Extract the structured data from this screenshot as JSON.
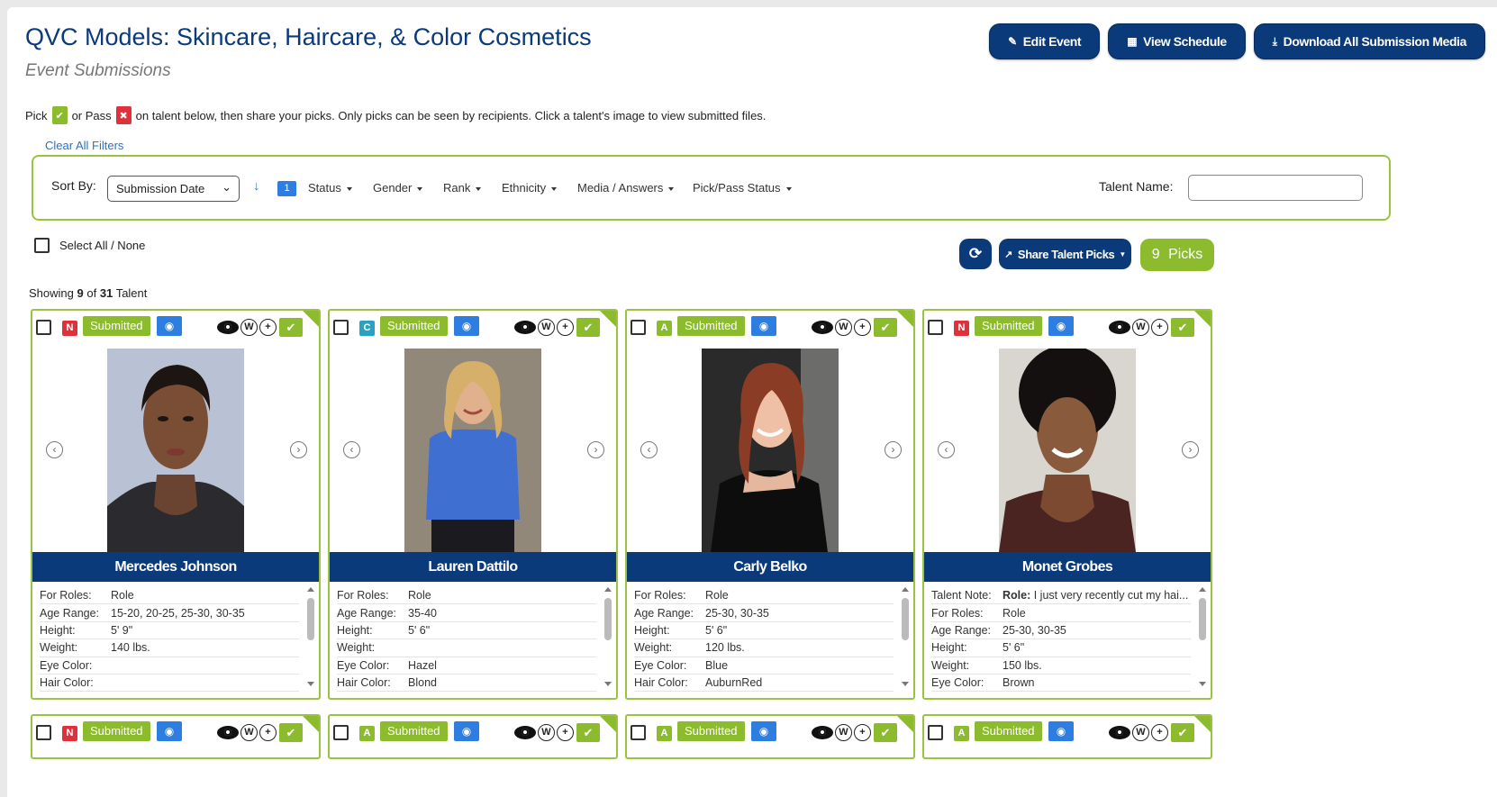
{
  "header": {
    "title": "QVC Models: Skincare, Haircare, & Color Cosmetics",
    "subtitle": "Event Submissions",
    "buttons": [
      {
        "label": "Edit Event",
        "icon": "edit-icon"
      },
      {
        "label": "View Schedule",
        "icon": "calendar-icon"
      },
      {
        "label": "Download All Submission Media",
        "icon": "download-icon"
      }
    ]
  },
  "instructions": {
    "pick_text": "Pick",
    "or_pass_text": "or Pass",
    "rest_text": "on talent below, then share your picks. Only picks can be seen by recipients. Click a talent's image to view submitted files."
  },
  "filters": {
    "clear_all": "Clear All Filters",
    "sort_by_label": "Sort By:",
    "sort_value": "Submission Date",
    "sort_badge": "1",
    "items": [
      "Status",
      "Gender",
      "Rank",
      "Ethnicity",
      "Media / Answers",
      "Pick/Pass Status"
    ],
    "talent_name_label": "Talent Name:",
    "talent_name_value": ""
  },
  "actions": {
    "select_all_label": "Select All / None",
    "share_label": "Share Talent Picks",
    "picks_count": "9",
    "picks_label": "Picks"
  },
  "showing": {
    "prefix": "Showing",
    "count": "9",
    "of": "of",
    "total": "31",
    "suffix": "Talent"
  },
  "card_common": {
    "status_label": "Submitted",
    "w_label": "W"
  },
  "cards": [
    {
      "name": "Mercedes Johnson",
      "rank": "N",
      "rows": [
        {
          "k": "For Roles:",
          "v": "Role"
        },
        {
          "k": "Age Range:",
          "v": "15-20, 20-25, 25-30, 30-35"
        },
        {
          "k": "Height:",
          "v": "5' 9\""
        },
        {
          "k": "Weight:",
          "v": "140 lbs."
        },
        {
          "k": "Eye Color:",
          "v": ""
        },
        {
          "k": "Hair Color:",
          "v": ""
        }
      ]
    },
    {
      "name": "Lauren Dattilo",
      "rank": "C",
      "rows": [
        {
          "k": "For Roles:",
          "v": "Role"
        },
        {
          "k": "Age Range:",
          "v": "35-40"
        },
        {
          "k": "Height:",
          "v": "5' 6\""
        },
        {
          "k": "Weight:",
          "v": ""
        },
        {
          "k": "Eye Color:",
          "v": "Hazel"
        },
        {
          "k": "Hair Color:",
          "v": "Blond"
        }
      ]
    },
    {
      "name": "Carly Belko",
      "rank": "A",
      "rows": [
        {
          "k": "For Roles:",
          "v": "Role"
        },
        {
          "k": "Age Range:",
          "v": "25-30, 30-35"
        },
        {
          "k": "Height:",
          "v": "5' 6\""
        },
        {
          "k": "Weight:",
          "v": "120 lbs."
        },
        {
          "k": "Eye Color:",
          "v": "Blue"
        },
        {
          "k": "Hair Color:",
          "v": "AuburnRed"
        }
      ]
    },
    {
      "name": "Monet Grobes",
      "rank": "N",
      "note_label": "Talent Note:",
      "note_bold": "Role:",
      "note_text": " I just very recently cut my hai...",
      "rows": [
        {
          "k": "For Roles:",
          "v": "Role"
        },
        {
          "k": "Age Range:",
          "v": "25-30, 30-35"
        },
        {
          "k": "Height:",
          "v": "5' 6\""
        },
        {
          "k": "Weight:",
          "v": "150 lbs."
        },
        {
          "k": "Eye Color:",
          "v": "Brown"
        }
      ]
    }
  ],
  "cards_row2_ranks": [
    "N",
    "A",
    "A",
    "A"
  ]
}
